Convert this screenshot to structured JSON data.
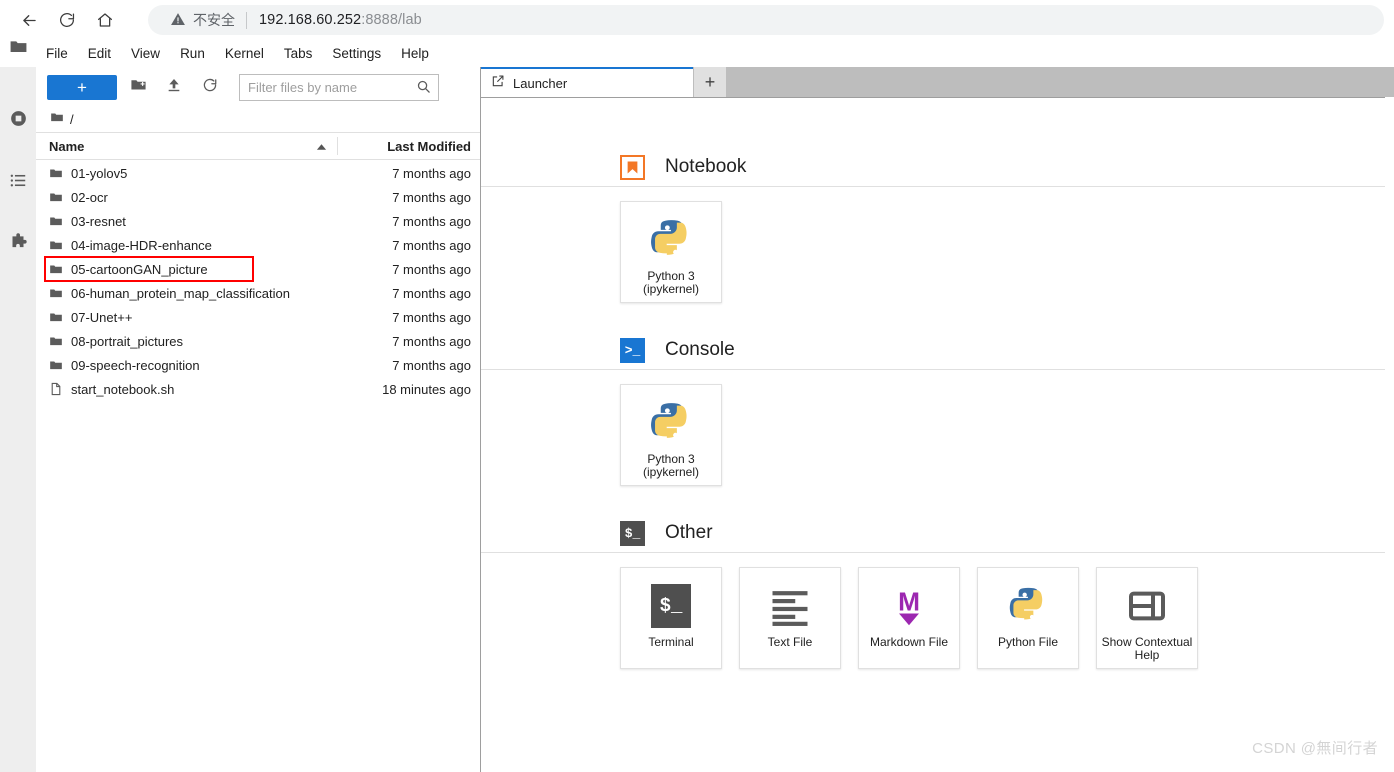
{
  "browser": {
    "back_icon": "arrow-left-icon",
    "reload_icon": "reload-icon",
    "home_icon": "home-icon",
    "security_label": "不安全",
    "security_icon": "warning-triangle-icon",
    "url_host": "192.168.60.252",
    "url_rest": ":8888/lab"
  },
  "menubar": {
    "logo": "jupyter-logo-icon",
    "items": [
      {
        "label": "File"
      },
      {
        "label": "Edit"
      },
      {
        "label": "View"
      },
      {
        "label": "Run"
      },
      {
        "label": "Kernel"
      },
      {
        "label": "Tabs"
      },
      {
        "label": "Settings"
      },
      {
        "label": "Help"
      }
    ]
  },
  "activity_bar": {
    "items": [
      {
        "name": "file-browser-icon",
        "active": true
      },
      {
        "name": "running-terminals-icon",
        "active": false
      },
      {
        "name": "commands-list-icon",
        "active": false
      },
      {
        "name": "extensions-puzzle-icon",
        "active": false
      }
    ]
  },
  "filebrowser": {
    "new_launcher_label": "+",
    "new_folder_icon": "new-folder-icon",
    "upload_icon": "upload-icon",
    "refresh_icon": "refresh-icon",
    "filter": {
      "value": "",
      "placeholder": "Filter files by name",
      "icon": "search-icon"
    },
    "breadcrumb": {
      "root_icon": "folder-icon",
      "path": "/"
    },
    "columns": {
      "name": "Name",
      "last_modified": "Last Modified",
      "sort_direction": "ascending"
    },
    "rows": [
      {
        "icon": "folder-icon",
        "name": "01-yolov5",
        "modified": "7 months ago",
        "highlighted": false
      },
      {
        "icon": "folder-icon",
        "name": "02-ocr",
        "modified": "7 months ago",
        "highlighted": false
      },
      {
        "icon": "folder-icon",
        "name": "03-resnet",
        "modified": "7 months ago",
        "highlighted": false
      },
      {
        "icon": "folder-icon",
        "name": "04-image-HDR-enhance",
        "modified": "7 months ago",
        "highlighted": false
      },
      {
        "icon": "folder-icon",
        "name": "05-cartoonGAN_picture",
        "modified": "7 months ago",
        "highlighted": true
      },
      {
        "icon": "folder-icon",
        "name": "06-human_protein_map_classification",
        "modified": "7 months ago",
        "highlighted": false
      },
      {
        "icon": "folder-icon",
        "name": "07-Unet++",
        "modified": "7 months ago",
        "highlighted": false
      },
      {
        "icon": "folder-icon",
        "name": "08-portrait_pictures",
        "modified": "7 months ago",
        "highlighted": false
      },
      {
        "icon": "folder-icon",
        "name": "09-speech-recognition",
        "modified": "7 months ago",
        "highlighted": false
      },
      {
        "icon": "file-icon",
        "name": "start_notebook.sh",
        "modified": "18 minutes ago",
        "highlighted": false
      }
    ],
    "highlight_color": "#ff0000"
  },
  "tabbar": {
    "tabs": [
      {
        "label": "Launcher",
        "icon": "launcher-icon",
        "active": true
      }
    ],
    "add_tab_label": "+"
  },
  "launcher": {
    "sections": [
      {
        "title": "Notebook",
        "icon": "notebook-bookmark-icon",
        "cards": [
          {
            "label": "Python 3\n(ipykernel)",
            "icon": "python-logo-icon"
          }
        ]
      },
      {
        "title": "Console",
        "icon": "console-prompt-icon",
        "icon_glyph": ">_",
        "cards": [
          {
            "label": "Python 3\n(ipykernel)",
            "icon": "python-logo-icon"
          }
        ]
      },
      {
        "title": "Other",
        "icon": "other-shell-icon",
        "icon_glyph": "$_",
        "cards": [
          {
            "label": "Terminal",
            "icon": "terminal-icon",
            "glyph": "$_"
          },
          {
            "label": "Text File",
            "icon": "text-file-icon"
          },
          {
            "label": "Markdown File",
            "icon": "markdown-file-icon",
            "glyph": "M"
          },
          {
            "label": "Python File",
            "icon": "python-file-icon"
          },
          {
            "label": "Show Contextual Help",
            "icon": "contextual-help-icon"
          }
        ]
      }
    ]
  },
  "watermark": {
    "text": "CSDN @無间行者"
  },
  "colors": {
    "accent_blue": "#1976d2",
    "jupyter_orange": "#f37726",
    "markdown_purple": "#9c27b0",
    "highlight_red": "#ff0000",
    "tabbar_gray": "#bdbdbd"
  }
}
